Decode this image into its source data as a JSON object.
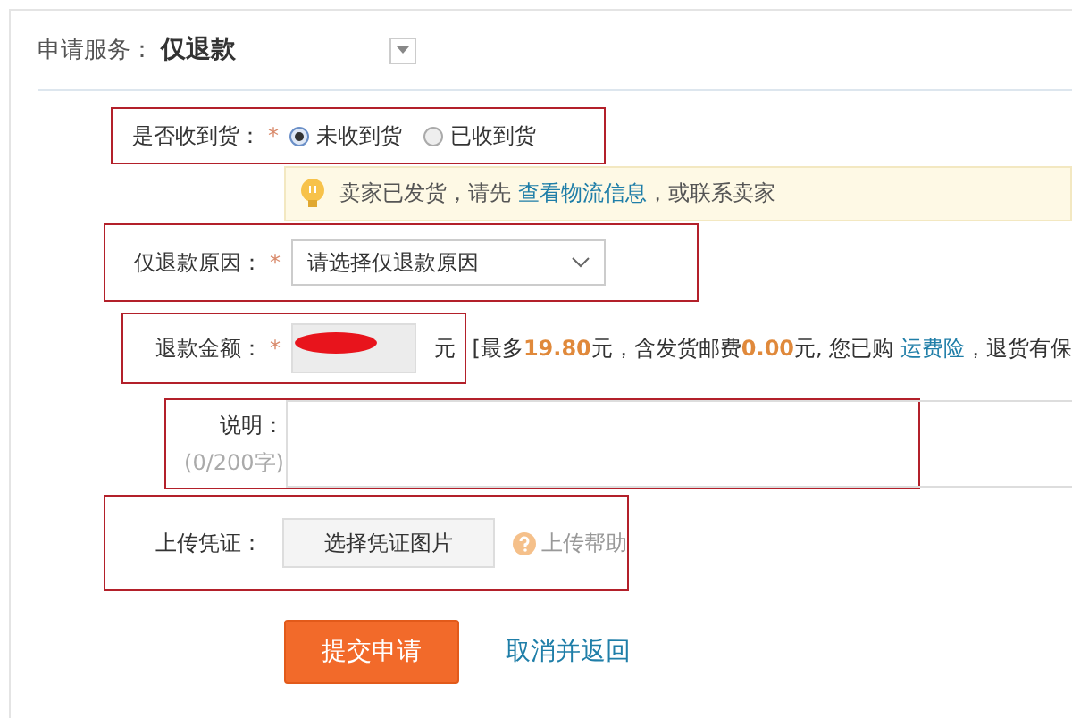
{
  "service": {
    "label": "申请服务：",
    "value": "仅退款"
  },
  "received": {
    "label": "是否收到货：",
    "required": "*",
    "annotated": true,
    "options": [
      {
        "label": "未收到货",
        "selected": true
      },
      {
        "label": "已收到货",
        "selected": false
      }
    ]
  },
  "notice": {
    "text": "卖家已发货，请先",
    "link": "查看物流信息",
    "tail": "，或联系卖家"
  },
  "reason": {
    "label": "仅退款原因：",
    "required": "*",
    "annotated": true,
    "value": "请选择仅退款原因"
  },
  "amount": {
    "label": "退款金额：",
    "required": "*",
    "annotated": true,
    "redacted": true,
    "unit": "元",
    "hint": "[最多**19.80**元，含发货邮费**0.00**元, 您已购",
    "hint_link": "运费险",
    "hint_tail": "，退货有保"
  },
  "note": {
    "label": "说明：",
    "counter": "(0/200字)",
    "annotated": true
  },
  "upload": {
    "label": "上传凭证：",
    "annotated": true,
    "button": "选择凭证图片",
    "help": "上传帮助"
  },
  "actions": {
    "submit": "提交申请",
    "cancel": "取消并返回"
  }
}
